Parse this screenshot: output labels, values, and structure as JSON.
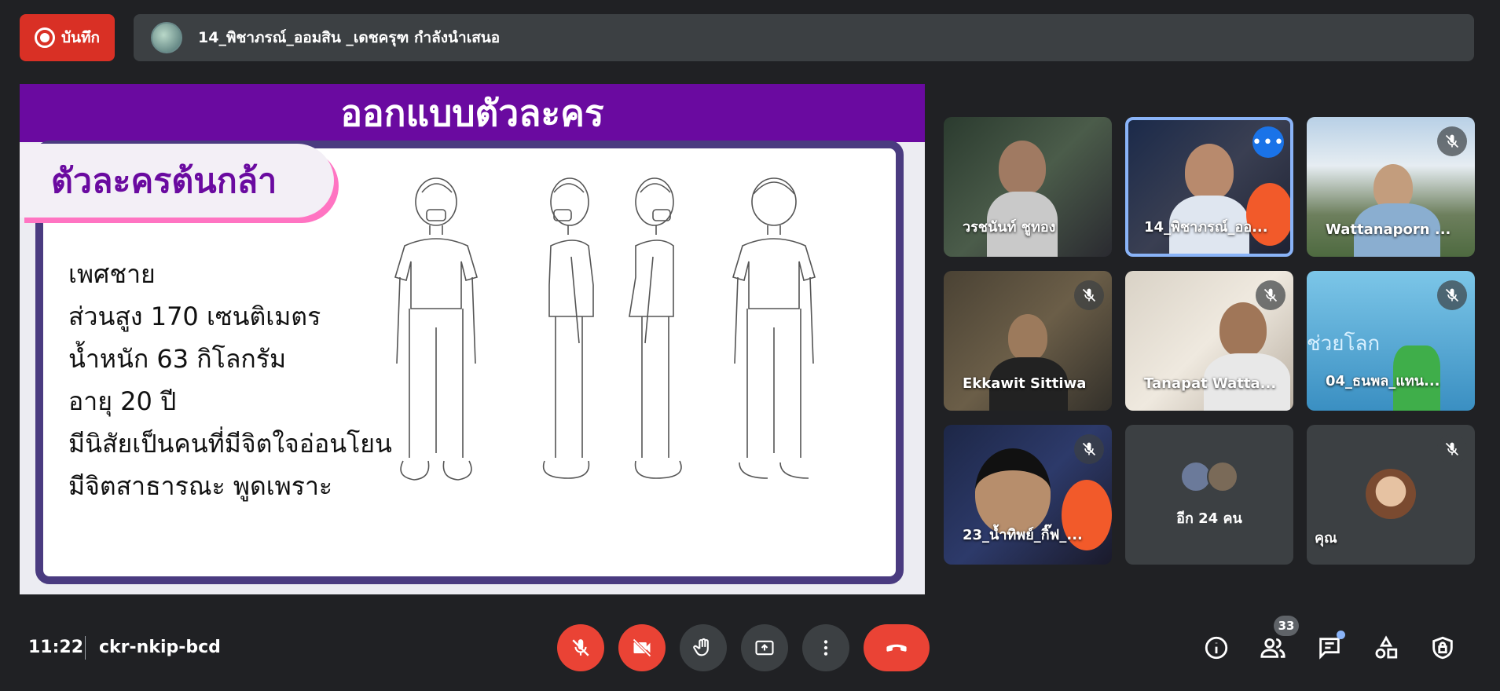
{
  "record": {
    "label": "บันทึก"
  },
  "presenter": {
    "text": "14_พิชาภรณ์_ออมสิน _เดชครุฑ กำลังนำเสนอ"
  },
  "slide": {
    "header": "ออกแบบตัวละคร",
    "tag": "ตัวละครต้นกล้า",
    "lines": [
      "เพศชาย",
      "ส่วนสูง 170 เซนติเมตร",
      "น้ำหนัก 63 กิโลกรัม",
      "อายุ 20 ปี",
      "มีนิสัยเป็นคนที่มีจิตใจอ่อนโยน",
      "มีจิตสาธารณะ พูดเพราะ"
    ]
  },
  "participants": [
    {
      "name": "วรชนันท์ ชูทอง"
    },
    {
      "name": "14_พิชาภรณ์_ออ..."
    },
    {
      "name": "Wattanaporn ..."
    },
    {
      "name": "Ekkawit Sittiwa"
    },
    {
      "name": "Tanapat Watta..."
    },
    {
      "name": "04_ธนพล_แทน..."
    },
    {
      "name": "23_น้ำทิพย์_กิ๊ฟ_..."
    },
    {
      "name": "อีก 24 คน"
    },
    {
      "name": "คุณ"
    }
  ],
  "tile_overlay_text": "ช่วยโลก",
  "footer": {
    "time": "11:22",
    "meeting_code": "ckr-nkip-bcd",
    "participant_count": "33"
  },
  "icons": [
    "record-icon",
    "mic-off-icon",
    "camera-off-icon",
    "raise-hand-icon",
    "present-icon",
    "more-options-icon",
    "hang-up-icon",
    "info-icon",
    "people-icon",
    "chat-icon",
    "activities-icon",
    "host-controls-icon"
  ],
  "colors": {
    "accent": "#8ab4f8",
    "danger": "#ea4335",
    "slide_purple": "#6a0aa0"
  }
}
